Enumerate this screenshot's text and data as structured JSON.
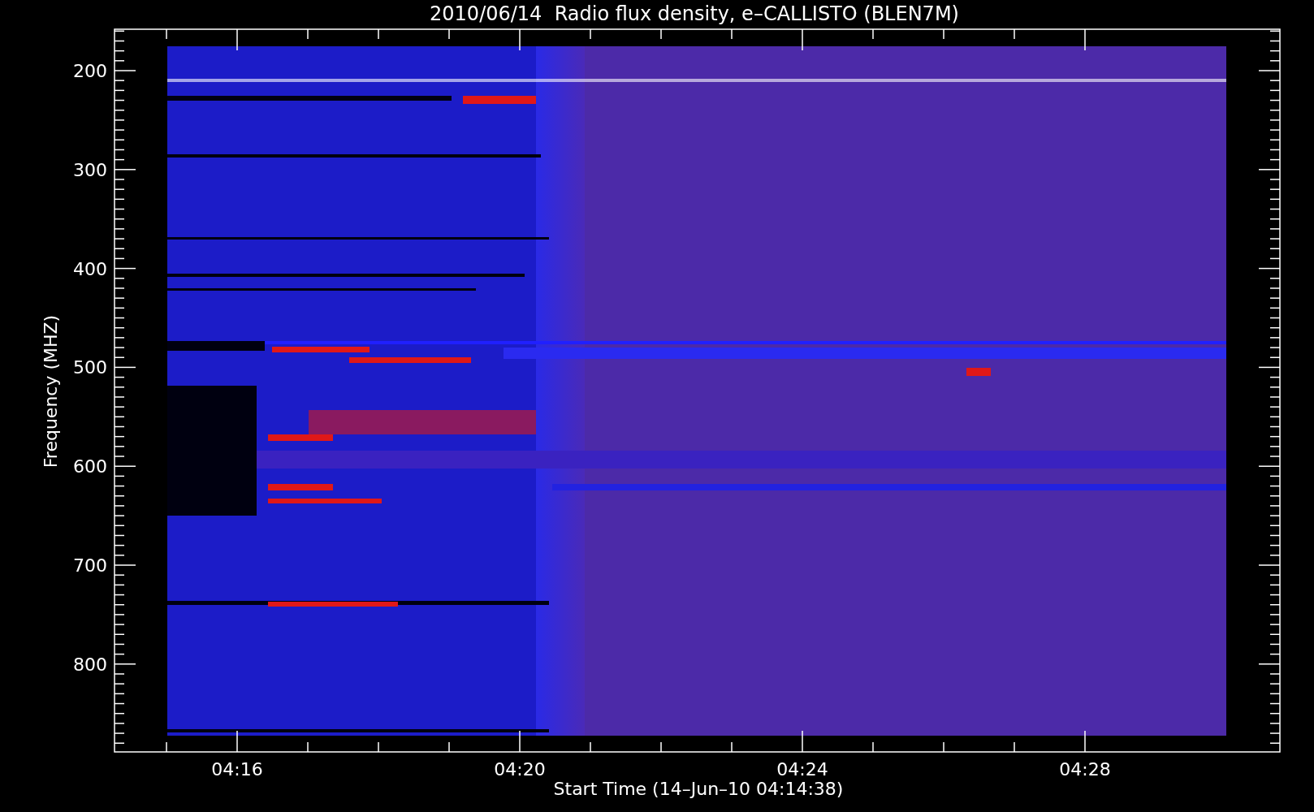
{
  "title": "2010/06/14  Radio flux density, e–CALLISTO (BLEN7M)",
  "y_axis": {
    "label": "Frequency (MHZ)",
    "ticks": [
      "200",
      "300",
      "400",
      "500",
      "600",
      "700",
      "800"
    ]
  },
  "x_axis": {
    "label": "Start Time (14–Jun–10 04:14:38)",
    "ticks": [
      "04:16",
      "04:20",
      "04:24",
      "04:28"
    ]
  }
}
